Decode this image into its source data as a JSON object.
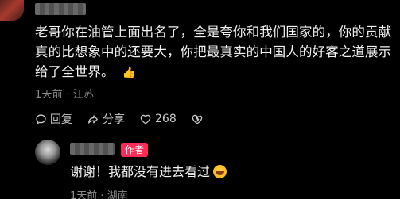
{
  "comment": {
    "text": "老哥你在油管上面出名了，全是夸你和我们国家的，你的贡献真的比想象中的还要大，你把最真实的中国人的好客之道展示给了全世界。",
    "emoji": "👍",
    "meta": "1天前 · 江苏",
    "actions": {
      "reply_label": "回复",
      "share_label": "分享",
      "like_count": "268"
    }
  },
  "reply": {
    "author_badge": "作者",
    "text": "谢谢！我都没有进去看过",
    "meta": "1天前 · 湖南"
  },
  "colors": {
    "background": "#000000",
    "badge": "#fe2c55",
    "meta_text": "#8c8c8c"
  }
}
